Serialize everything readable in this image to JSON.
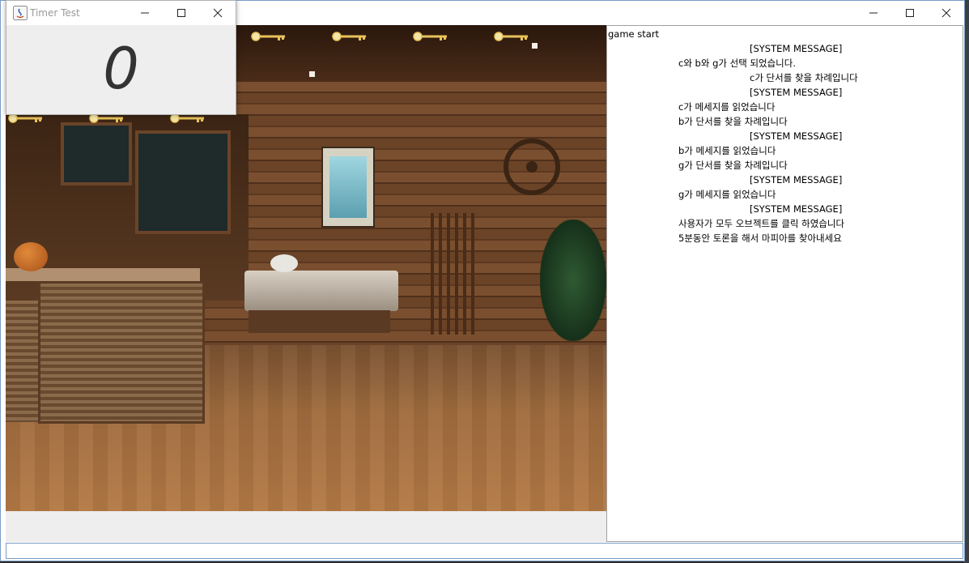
{
  "main_window": {
    "title": ""
  },
  "timer_window": {
    "title": "Timer Test",
    "value": "0"
  },
  "chat": {
    "lines": [
      "game start",
      "[SYSTEM MESSAGE]",
      "c와 b와 g가 선택 되었습니다.",
      "c가 단서를 찾을 차례입니다",
      "[SYSTEM MESSAGE]",
      "c가 메세지를 읽었습니다",
      "b가 단서를 찾을 차례입니다",
      "[SYSTEM MESSAGE]",
      "b가 메세지를 읽었습니다",
      "g가 단서를 찾을 차례입니다",
      "[SYSTEM MESSAGE]",
      "g가 메세지를 읽었습니다",
      "[SYSTEM MESSAGE]",
      "사용자가 모두 오브젝트를 클릭 하였습니다",
      "5분동안 토론을 해서 마피아를 찾아내세요"
    ]
  },
  "input": {
    "value": ""
  },
  "icons": {
    "window_controls": [
      "minimize-icon",
      "maximize-icon",
      "close-icon"
    ],
    "keys": "key-icon",
    "app_icon": "java-icon"
  },
  "colors": {
    "window_border": "#7a9cc6",
    "timer_bg": "#eeeeee",
    "key_gold": "#e8c25a"
  }
}
